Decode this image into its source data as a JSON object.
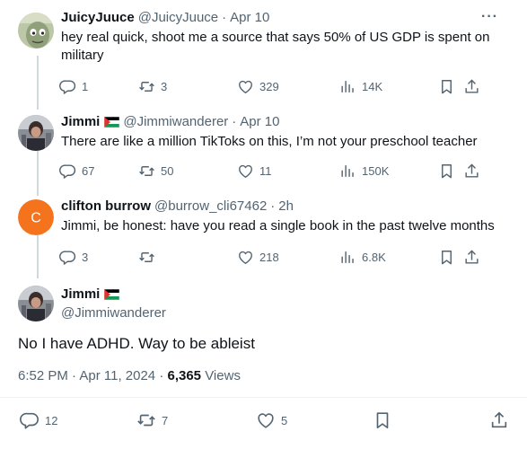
{
  "thread": [
    {
      "name": "JuicyJuuce",
      "handle": "@JuicyJuuce",
      "sep": "·",
      "time": "Apr 10",
      "text": "hey real quick, shoot me a source that says 50% of US GDP is spent on military",
      "replies": "1",
      "reposts": "3",
      "likes": "329",
      "views": "14K",
      "more": "···"
    },
    {
      "name": "Jimmi",
      "handle": "@Jimmiwanderer",
      "sep": "·",
      "time": "Apr 10",
      "text": "There are like a million TikToks on this, I’m not your preschool teacher",
      "replies": "67",
      "reposts": "50",
      "likes": "11",
      "views": "150K"
    },
    {
      "name": "clifton burrow",
      "handle": "@burrow_cli67462",
      "sep": "·",
      "time": "2h",
      "avatar_letter": "C",
      "avatar_color": "#f4731c",
      "text": "Jimmi, be honest: have you read a single book in the past twelve months",
      "replies": "3",
      "reposts": "",
      "likes": "218",
      "views": "6.8K"
    }
  ],
  "main": {
    "name": "Jimmi",
    "handle": "@Jimmiwanderer",
    "text": "No I have ADHD. Way to be ableist",
    "time": "6:52 PM · Apr 11, 2024 · ",
    "views_count": "6,365",
    "views_label": " Views",
    "replies": "12",
    "reposts": "7",
    "likes": "5"
  },
  "colors": {
    "text": "#0f1419",
    "secondary": "#536471",
    "line": "#cfd9de",
    "divider": "#eff3f4"
  }
}
